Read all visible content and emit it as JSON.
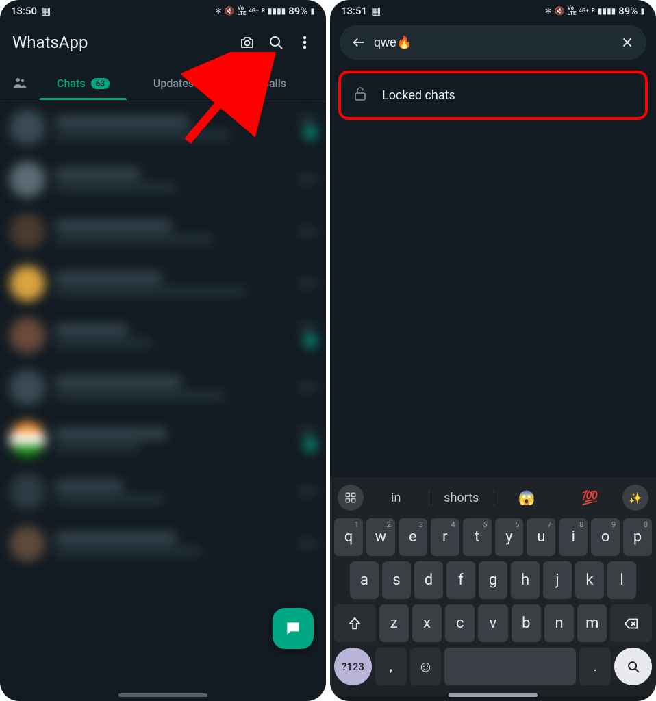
{
  "left": {
    "status": {
      "time": "13:50",
      "battery": "89%",
      "icons": "✻ 🔇 VoLTE 4G+ R 📶"
    },
    "app_title": "WhatsApp",
    "tabs": {
      "chats": "Chats",
      "chats_count": "63",
      "updates": "Updates",
      "calls": "Calls"
    }
  },
  "right": {
    "status": {
      "time": "13:51",
      "battery": "89%",
      "icons": "✻ 🔇 VoLTE 4G+ R 📶"
    },
    "search": {
      "query": "qwe🔥"
    },
    "result": {
      "label": "Locked chats"
    },
    "suggestions": {
      "s1": "in",
      "s2": "shorts",
      "e1": "😱",
      "e2": "💯"
    },
    "keys": {
      "row1": [
        "q",
        "w",
        "e",
        "r",
        "t",
        "y",
        "u",
        "i",
        "o",
        "p"
      ],
      "row1_sup": [
        "1",
        "2",
        "3",
        "4",
        "5",
        "6",
        "7",
        "8",
        "9",
        "0"
      ],
      "row2": [
        "a",
        "s",
        "d",
        "f",
        "g",
        "h",
        "j",
        "k",
        "l"
      ],
      "row3": [
        "z",
        "x",
        "c",
        "v",
        "b",
        "n",
        "m"
      ],
      "sym": "?123",
      "comma": ",",
      "period": "."
    }
  }
}
